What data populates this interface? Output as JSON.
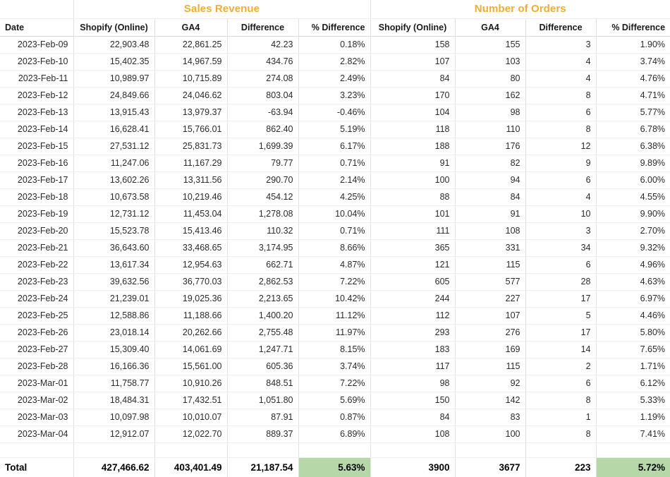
{
  "groups": {
    "left_title": "Sales Revenue",
    "right_title": "Number of Orders"
  },
  "colors": {
    "group_title": "#f0ad34",
    "highlight": "#b6d7a8"
  },
  "headers": {
    "date": "Date",
    "left": {
      "shopify": "Shopify (Online)",
      "ga4": "GA4",
      "difference": "Difference",
      "pct_difference": "% Difference"
    },
    "right": {
      "shopify": "Shopify (Online)",
      "ga4": "GA4",
      "difference": "Difference",
      "pct_difference": "% Difference"
    }
  },
  "rows": [
    {
      "date": "2023-Feb-09",
      "rev_shopify": "22,903.48",
      "rev_ga4": "22,861.25",
      "rev_diff": "42.23",
      "rev_pct": "0.18%",
      "ord_shopify": "158",
      "ord_ga4": "155",
      "ord_diff": "3",
      "ord_pct": "1.90%"
    },
    {
      "date": "2023-Feb-10",
      "rev_shopify": "15,402.35",
      "rev_ga4": "14,967.59",
      "rev_diff": "434.76",
      "rev_pct": "2.82%",
      "ord_shopify": "107",
      "ord_ga4": "103",
      "ord_diff": "4",
      "ord_pct": "3.74%"
    },
    {
      "date": "2023-Feb-11",
      "rev_shopify": "10,989.97",
      "rev_ga4": "10,715.89",
      "rev_diff": "274.08",
      "rev_pct": "2.49%",
      "ord_shopify": "84",
      "ord_ga4": "80",
      "ord_diff": "4",
      "ord_pct": "4.76%"
    },
    {
      "date": "2023-Feb-12",
      "rev_shopify": "24,849.66",
      "rev_ga4": "24,046.62",
      "rev_diff": "803.04",
      "rev_pct": "3.23%",
      "ord_shopify": "170",
      "ord_ga4": "162",
      "ord_diff": "8",
      "ord_pct": "4.71%"
    },
    {
      "date": "2023-Feb-13",
      "rev_shopify": "13,915.43",
      "rev_ga4": "13,979.37",
      "rev_diff": "-63.94",
      "rev_pct": "-0.46%",
      "ord_shopify": "104",
      "ord_ga4": "98",
      "ord_diff": "6",
      "ord_pct": "5.77%"
    },
    {
      "date": "2023-Feb-14",
      "rev_shopify": "16,628.41",
      "rev_ga4": "15,766.01",
      "rev_diff": "862.40",
      "rev_pct": "5.19%",
      "ord_shopify": "118",
      "ord_ga4": "110",
      "ord_diff": "8",
      "ord_pct": "6.78%"
    },
    {
      "date": "2023-Feb-15",
      "rev_shopify": "27,531.12",
      "rev_ga4": "25,831.73",
      "rev_diff": "1,699.39",
      "rev_pct": "6.17%",
      "ord_shopify": "188",
      "ord_ga4": "176",
      "ord_diff": "12",
      "ord_pct": "6.38%"
    },
    {
      "date": "2023-Feb-16",
      "rev_shopify": "11,247.06",
      "rev_ga4": "11,167.29",
      "rev_diff": "79.77",
      "rev_pct": "0.71%",
      "ord_shopify": "91",
      "ord_ga4": "82",
      "ord_diff": "9",
      "ord_pct": "9.89%"
    },
    {
      "date": "2023-Feb-17",
      "rev_shopify": "13,602.26",
      "rev_ga4": "13,311.56",
      "rev_diff": "290.70",
      "rev_pct": "2.14%",
      "ord_shopify": "100",
      "ord_ga4": "94",
      "ord_diff": "6",
      "ord_pct": "6.00%"
    },
    {
      "date": "2023-Feb-18",
      "rev_shopify": "10,673.58",
      "rev_ga4": "10,219.46",
      "rev_diff": "454.12",
      "rev_pct": "4.25%",
      "ord_shopify": "88",
      "ord_ga4": "84",
      "ord_diff": "4",
      "ord_pct": "4.55%"
    },
    {
      "date": "2023-Feb-19",
      "rev_shopify": "12,731.12",
      "rev_ga4": "11,453.04",
      "rev_diff": "1,278.08",
      "rev_pct": "10.04%",
      "ord_shopify": "101",
      "ord_ga4": "91",
      "ord_diff": "10",
      "ord_pct": "9.90%"
    },
    {
      "date": "2023-Feb-20",
      "rev_shopify": "15,523.78",
      "rev_ga4": "15,413.46",
      "rev_diff": "110.32",
      "rev_pct": "0.71%",
      "ord_shopify": "111",
      "ord_ga4": "108",
      "ord_diff": "3",
      "ord_pct": "2.70%"
    },
    {
      "date": "2023-Feb-21",
      "rev_shopify": "36,643.60",
      "rev_ga4": "33,468.65",
      "rev_diff": "3,174.95",
      "rev_pct": "8.66%",
      "ord_shopify": "365",
      "ord_ga4": "331",
      "ord_diff": "34",
      "ord_pct": "9.32%"
    },
    {
      "date": "2023-Feb-22",
      "rev_shopify": "13,617.34",
      "rev_ga4": "12,954.63",
      "rev_diff": "662.71",
      "rev_pct": "4.87%",
      "ord_shopify": "121",
      "ord_ga4": "115",
      "ord_diff": "6",
      "ord_pct": "4.96%"
    },
    {
      "date": "2023-Feb-23",
      "rev_shopify": "39,632.56",
      "rev_ga4": "36,770.03",
      "rev_diff": "2,862.53",
      "rev_pct": "7.22%",
      "ord_shopify": "605",
      "ord_ga4": "577",
      "ord_diff": "28",
      "ord_pct": "4.63%"
    },
    {
      "date": "2023-Feb-24",
      "rev_shopify": "21,239.01",
      "rev_ga4": "19,025.36",
      "rev_diff": "2,213.65",
      "rev_pct": "10.42%",
      "ord_shopify": "244",
      "ord_ga4": "227",
      "ord_diff": "17",
      "ord_pct": "6.97%"
    },
    {
      "date": "2023-Feb-25",
      "rev_shopify": "12,588.86",
      "rev_ga4": "11,188.66",
      "rev_diff": "1,400.20",
      "rev_pct": "11.12%",
      "ord_shopify": "112",
      "ord_ga4": "107",
      "ord_diff": "5",
      "ord_pct": "4.46%"
    },
    {
      "date": "2023-Feb-26",
      "rev_shopify": "23,018.14",
      "rev_ga4": "20,262.66",
      "rev_diff": "2,755.48",
      "rev_pct": "11.97%",
      "ord_shopify": "293",
      "ord_ga4": "276",
      "ord_diff": "17",
      "ord_pct": "5.80%"
    },
    {
      "date": "2023-Feb-27",
      "rev_shopify": "15,309.40",
      "rev_ga4": "14,061.69",
      "rev_diff": "1,247.71",
      "rev_pct": "8.15%",
      "ord_shopify": "183",
      "ord_ga4": "169",
      "ord_diff": "14",
      "ord_pct": "7.65%"
    },
    {
      "date": "2023-Feb-28",
      "rev_shopify": "16,166.36",
      "rev_ga4": "15,561.00",
      "rev_diff": "605.36",
      "rev_pct": "3.74%",
      "ord_shopify": "117",
      "ord_ga4": "115",
      "ord_diff": "2",
      "ord_pct": "1.71%"
    },
    {
      "date": "2023-Mar-01",
      "rev_shopify": "11,758.77",
      "rev_ga4": "10,910.26",
      "rev_diff": "848.51",
      "rev_pct": "7.22%",
      "ord_shopify": "98",
      "ord_ga4": "92",
      "ord_diff": "6",
      "ord_pct": "6.12%"
    },
    {
      "date": "2023-Mar-02",
      "rev_shopify": "18,484.31",
      "rev_ga4": "17,432.51",
      "rev_diff": "1,051.80",
      "rev_pct": "5.69%",
      "ord_shopify": "150",
      "ord_ga4": "142",
      "ord_diff": "8",
      "ord_pct": "5.33%"
    },
    {
      "date": "2023-Mar-03",
      "rev_shopify": "10,097.98",
      "rev_ga4": "10,010.07",
      "rev_diff": "87.91",
      "rev_pct": "0.87%",
      "ord_shopify": "84",
      "ord_ga4": "83",
      "ord_diff": "1",
      "ord_pct": "1.19%"
    },
    {
      "date": "2023-Mar-04",
      "rev_shopify": "12,912.07",
      "rev_ga4": "12,022.70",
      "rev_diff": "889.37",
      "rev_pct": "6.89%",
      "ord_shopify": "108",
      "ord_ga4": "100",
      "ord_diff": "8",
      "ord_pct": "7.41%"
    }
  ],
  "total": {
    "label": "Total",
    "rev_shopify": "427,466.62",
    "rev_ga4": "403,401.49",
    "rev_diff": "21,187.54",
    "rev_pct": "5.63%",
    "ord_shopify": "3900",
    "ord_ga4": "3677",
    "ord_diff": "223",
    "ord_pct": "5.72%"
  }
}
